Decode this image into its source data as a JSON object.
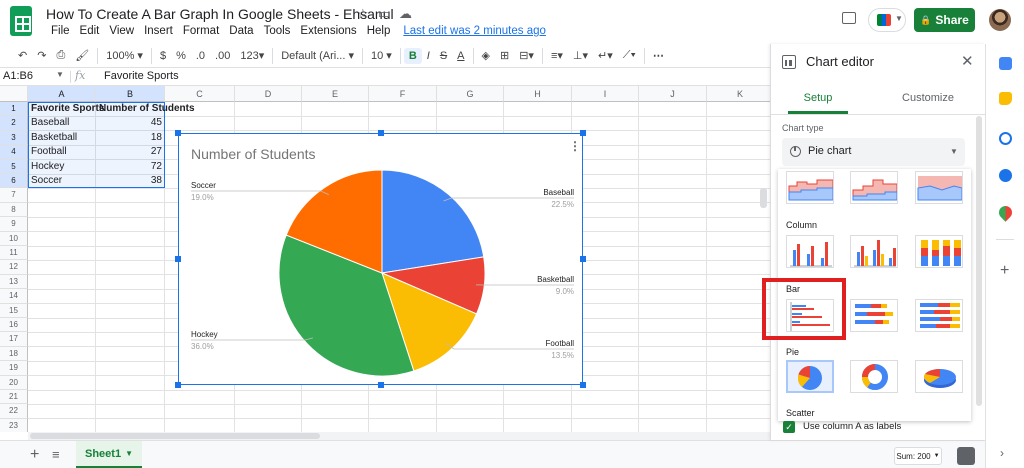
{
  "window": {
    "title": "How To Create A Bar Graph In Google Sheets - Ehsanul",
    "menu": [
      "File",
      "Edit",
      "View",
      "Insert",
      "Format",
      "Data",
      "Tools",
      "Extensions",
      "Help"
    ],
    "last_edit": "Last edit was 2 minutes ago",
    "share_label": "Share"
  },
  "toolbar": {
    "zoom": "100%",
    "currency": "$",
    "percent": "%",
    "dec_decrease": ".0",
    "dec_increase": ".00",
    "more_formats": "123",
    "font": "Default (Ari...",
    "font_size": "10",
    "bold": "B",
    "italic": "I",
    "strike": "S",
    "text_color": "A"
  },
  "formula_bar": {
    "name_box": "A1:B6",
    "fx": "fx",
    "value": "Favorite Sports"
  },
  "grid": {
    "columns": [
      "A",
      "B",
      "C",
      "D",
      "E",
      "F",
      "G",
      "H",
      "I",
      "J",
      "K"
    ],
    "rows": [
      "1",
      "2",
      "3",
      "4",
      "5",
      "6",
      "7",
      "8",
      "9",
      "10",
      "11",
      "12",
      "13",
      "14",
      "15",
      "16",
      "17",
      "18",
      "19",
      "20",
      "21",
      "22",
      "23"
    ],
    "header": [
      "Favorite Sports",
      "Number of Students"
    ],
    "data": [
      [
        "Baseball",
        "45"
      ],
      [
        "Basketball",
        "18"
      ],
      [
        "Football",
        "27"
      ],
      [
        "Hockey",
        "72"
      ],
      [
        "Soccer",
        "38"
      ]
    ]
  },
  "chart_data": {
    "type": "pie",
    "title": "Number of Students",
    "categories": [
      "Baseball",
      "Basketball",
      "Football",
      "Hockey",
      "Soccer"
    ],
    "values": [
      45,
      18,
      27,
      72,
      38
    ],
    "percent_labels": [
      "22.5%",
      "9.0%",
      "13.5%",
      "36.0%",
      "19.0%"
    ],
    "colors": [
      "#4285f4",
      "#ea4335",
      "#fbbc04",
      "#34a853",
      "#ff6d01"
    ]
  },
  "editor": {
    "title": "Chart editor",
    "tabs": [
      "Setup",
      "Customize"
    ],
    "chart_type_label": "Chart type",
    "chart_type_value": "Pie chart",
    "sections": {
      "column": "Column",
      "bar": "Bar",
      "pie": "Pie",
      "scatter": "Scatter"
    },
    "use_column_label": "Use column A as labels"
  },
  "bottom": {
    "sheet_tab": "Sheet1",
    "sum": "Sum: 200"
  },
  "colors": {
    "accent_green": "#188038",
    "selection_blue": "#1a73e8",
    "highlight_red": "#e02020"
  }
}
